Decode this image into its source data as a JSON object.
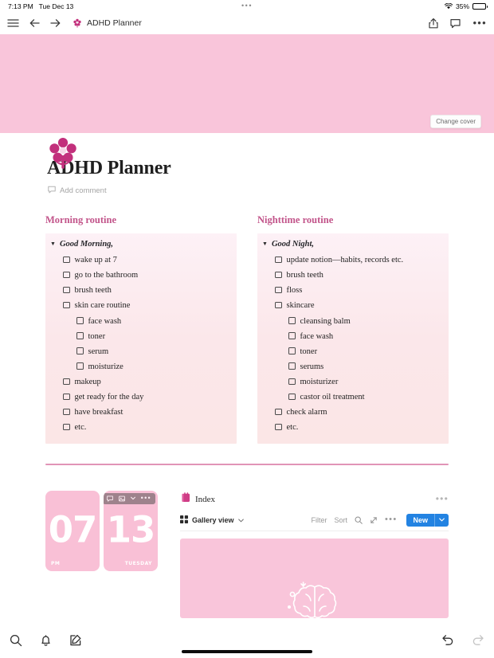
{
  "status_bar": {
    "time": "7:13 PM",
    "date": "Tue Dec 13",
    "center_dots": "•••",
    "battery_percent": "35%",
    "wifi_icon": "wifi-icon",
    "battery_icon": "battery-icon"
  },
  "topbar": {
    "menu_icon": "hamburger-menu-icon",
    "back_icon": "back-arrow-icon",
    "forward_icon": "forward-arrow-icon",
    "page_emoji": "flower-icon",
    "title": "ADHD Planner",
    "share_icon": "share-icon",
    "comment_icon": "comment-icon",
    "more_icon": "more-options-icon",
    "more_glyph": "•••"
  },
  "cover": {
    "change_cover_label": "Change cover",
    "color": "#f9c5da"
  },
  "page": {
    "icon": "flower-icon",
    "title": "ADHD Planner",
    "add_comment_label": "Add comment",
    "accent_color": "#c2548a",
    "divider_color": "#e194b7"
  },
  "columns": [
    {
      "heading": "Morning routine",
      "toggle_label": "Good Morning,",
      "toggle_glyph": "▼",
      "items": [
        {
          "label": "wake up at 7",
          "nested": false
        },
        {
          "label": "go to the bathroom",
          "nested": false
        },
        {
          "label": "brush teeth",
          "nested": false
        },
        {
          "label": "skin care routine",
          "nested": false
        },
        {
          "label": "face wash",
          "nested": true
        },
        {
          "label": "toner",
          "nested": true
        },
        {
          "label": "serum",
          "nested": true
        },
        {
          "label": "moisturize",
          "nested": true
        },
        {
          "label": "makeup",
          "nested": false
        },
        {
          "label": "get ready for the day",
          "nested": false
        },
        {
          "label": "have breakfast",
          "nested": false
        },
        {
          "label": "etc.",
          "nested": false
        }
      ]
    },
    {
      "heading": "Nighttime routine",
      "toggle_label": "Good Night,",
      "toggle_glyph": "▼",
      "items": [
        {
          "label": "update notion—habits, records etc.",
          "nested": false
        },
        {
          "label": "brush teeth",
          "nested": false
        },
        {
          "label": "floss",
          "nested": false
        },
        {
          "label": "skincare",
          "nested": false
        },
        {
          "label": "cleansing balm",
          "nested": true
        },
        {
          "label": "face wash",
          "nested": true
        },
        {
          "label": "toner",
          "nested": true
        },
        {
          "label": "serums",
          "nested": true
        },
        {
          "label": "moisturizer",
          "nested": true
        },
        {
          "label": "castor oil treatment",
          "nested": true
        },
        {
          "label": "check alarm",
          "nested": false
        },
        {
          "label": "etc.",
          "nested": false
        }
      ]
    }
  ],
  "clock_cards": [
    {
      "number": "07",
      "label": "PM",
      "label_side": "left"
    },
    {
      "number": "13",
      "label": "TUESDAY",
      "label_side": "right"
    }
  ],
  "card_toolbar": {
    "comment_icon": "comment-icon",
    "image_icon": "image-options-icon",
    "caret_icon": "chevron-down-icon",
    "more_icon": "more-options-icon",
    "more_glyph": "•••"
  },
  "database": {
    "icon": "notebook-icon",
    "title": "Index",
    "more_glyph": "•••",
    "view_icon": "gallery-view-icon",
    "view_label": "Gallery view",
    "view_caret": "chevron-down-icon",
    "filter_label": "Filter",
    "sort_label": "Sort",
    "search_icon": "search-icon",
    "expand_icon": "expand-icon",
    "more_icon": "more-options-icon",
    "new_label": "New",
    "new_caret_icon": "chevron-down-icon",
    "new_button_color": "#2383e2",
    "gallery_card_color": "#f9c5da",
    "gallery_card_art": "brain-illustration"
  },
  "bottombar": {
    "search_icon": "search-icon",
    "notifications_icon": "bell-icon",
    "new_page_icon": "compose-icon",
    "undo_icon": "undo-icon",
    "redo_icon": "redo-icon"
  }
}
